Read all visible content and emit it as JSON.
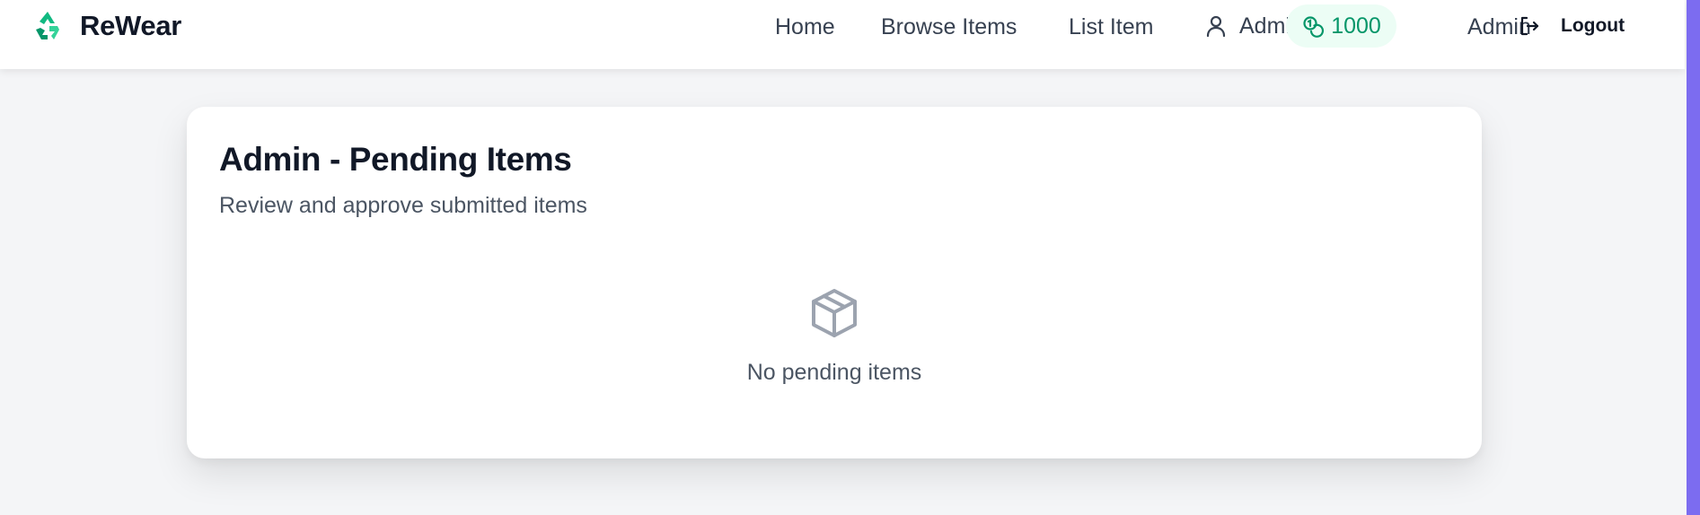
{
  "brand": {
    "name": "ReWear",
    "logo_icon": "recycle-icon",
    "logo_color": "#10b981"
  },
  "nav": {
    "home_label": "Home",
    "browse_label": "Browse Items",
    "list_label": "List Item",
    "user_name": "Admin",
    "user_icon": "user-icon",
    "points": "1000",
    "points_icon": "coins-icon",
    "admin_label": "Admin",
    "logout_label": "Logout",
    "logout_icon": "logout-icon"
  },
  "page": {
    "title": "Admin - Pending Items",
    "subtitle": "Review and approve submitted items",
    "empty_icon": "package-icon",
    "empty_message": "No pending items"
  },
  "colors": {
    "accent": "#10b981",
    "points_text": "#059669",
    "points_bg": "#ecfdf5",
    "scrollbar": "#7c6cf0"
  }
}
